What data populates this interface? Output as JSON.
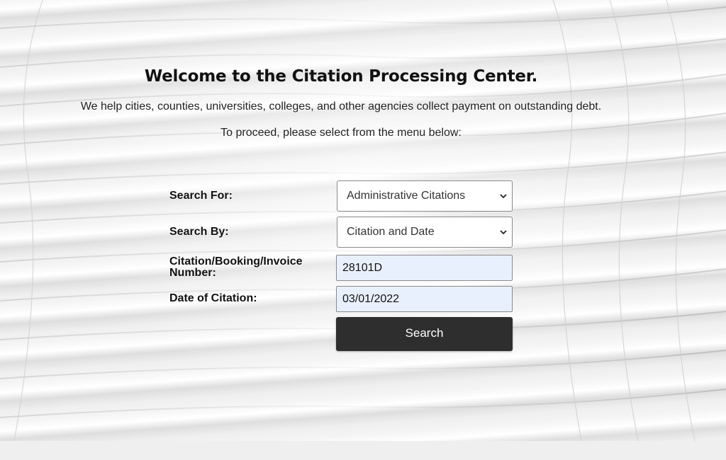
{
  "header": {
    "title": "Welcome to the Citation Processing Center.",
    "intro": "We help cities, counties, universities, colleges, and other agencies collect payment on outstanding debt.",
    "instruction": "To proceed, please select from the menu below:"
  },
  "form": {
    "search_for": {
      "label": "Search For:",
      "selected": "Administrative Citations"
    },
    "search_by": {
      "label": "Search By:",
      "selected": "Citation and Date"
    },
    "citation_number": {
      "label": "Citation/Booking/Invoice Number:",
      "value": "28101D"
    },
    "citation_date": {
      "label": "Date of Citation:",
      "value": "03/01/2022"
    },
    "submit_label": "Search"
  },
  "icons": {
    "dropdown": "chevron-down-icon"
  },
  "colors": {
    "button_bg": "#2e2e2e",
    "input_bg": "#e8f0fe"
  }
}
